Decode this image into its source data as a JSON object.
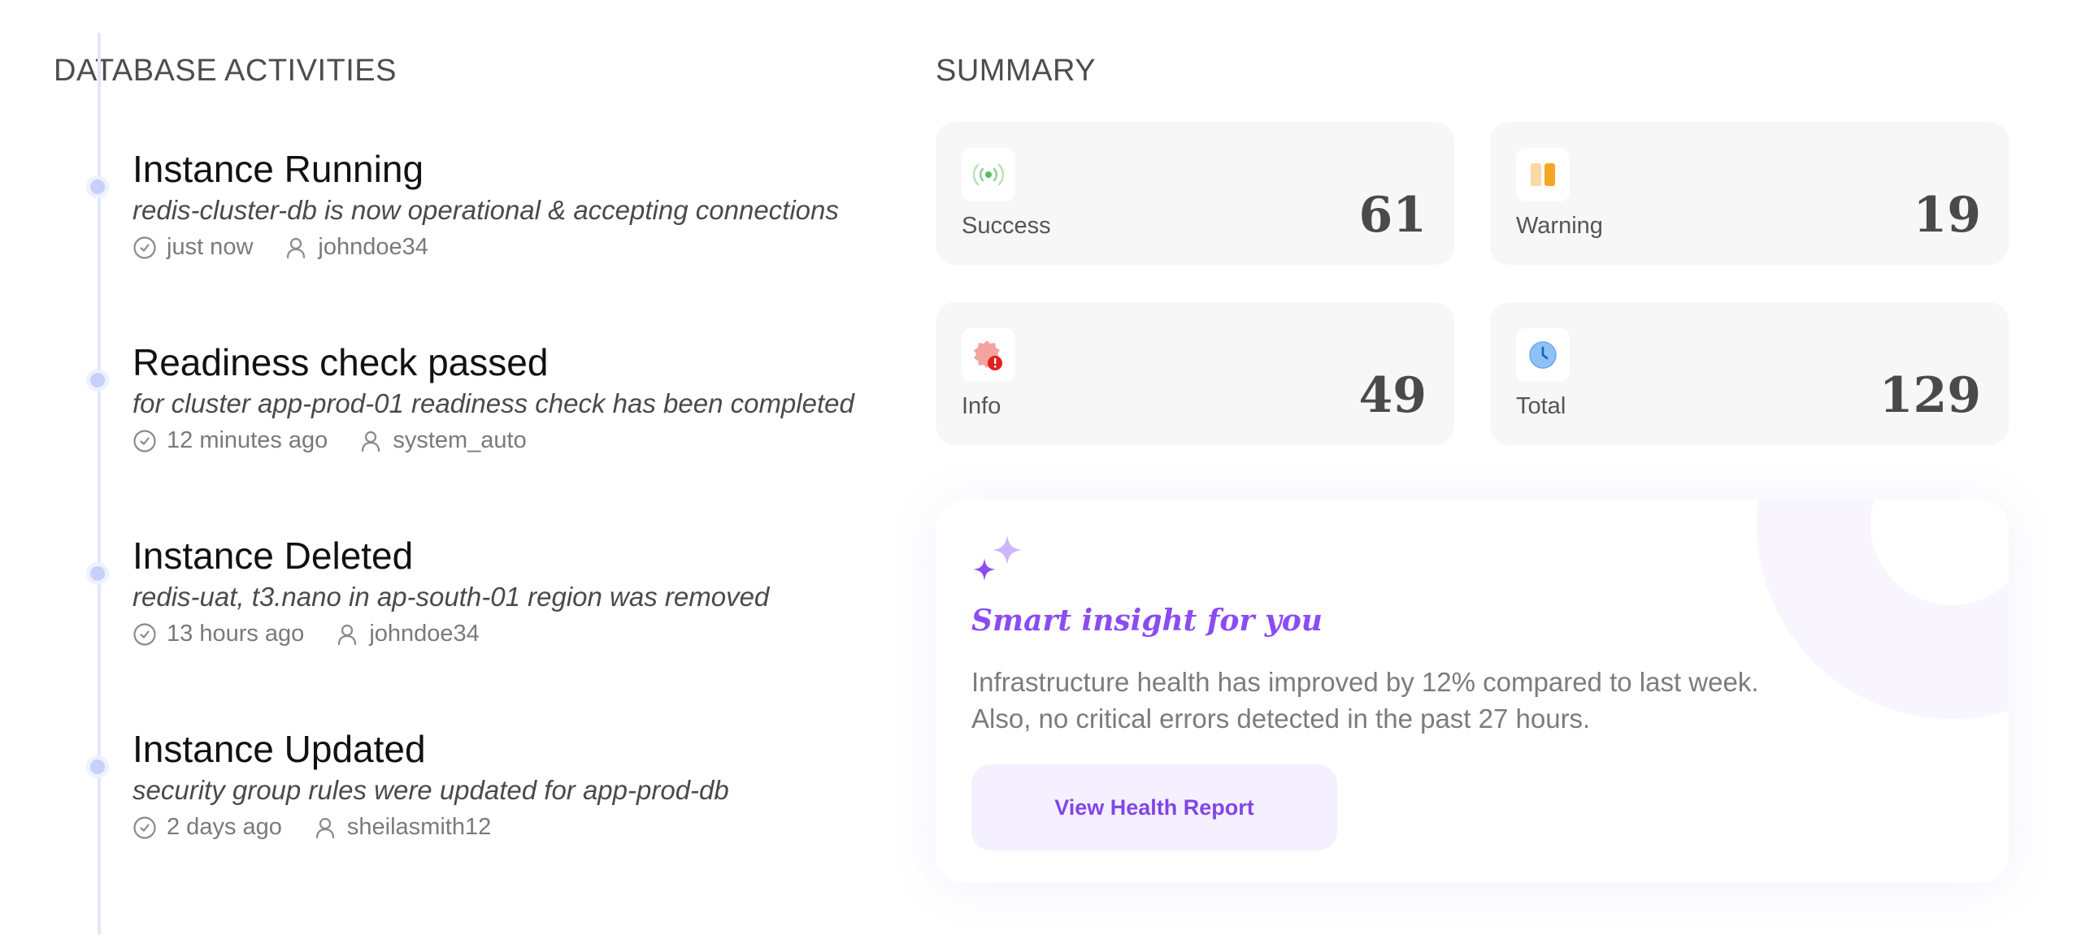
{
  "activities": {
    "title": "DATABASE ACTIVITIES",
    "items": [
      {
        "title": "Instance Running",
        "description": "redis-cluster-db is now operational & accepting connections",
        "time": "just now",
        "user": "johndoe34"
      },
      {
        "title": "Readiness check passed",
        "description": "for cluster app-prod-01 readiness check has been completed",
        "time": "12 minutes ago",
        "user": "system_auto"
      },
      {
        "title": "Instance Deleted",
        "description": "redis-uat, t3.nano in ap-south-01 region was removed",
        "time": "13 hours ago",
        "user": "johndoe34"
      },
      {
        "title": "Instance Updated",
        "description": "security group rules were updated for app-prod-db",
        "time": "2 days ago",
        "user": "sheilasmith12"
      }
    ]
  },
  "summary": {
    "title": "SUMMARY",
    "cards": [
      {
        "label": "Success",
        "count": "61",
        "icon": "signal-broadcast-icon",
        "color": "#5cb85c"
      },
      {
        "label": "Warning",
        "count": "19",
        "icon": "warning-bars-icon",
        "color": "#f5a623"
      },
      {
        "label": "Info",
        "count": "49",
        "icon": "alert-badge-icon",
        "color": "#e8453c"
      },
      {
        "label": "Total",
        "count": "129",
        "icon": "clock-icon",
        "color": "#4a90e2"
      }
    ]
  },
  "insight": {
    "headline": "Smart insight for you",
    "body_line1": "Infrastructure health has improved by 12% compared to last week.",
    "body_line2": "Also, no critical errors detected in the past 27 hours.",
    "button_label": "View Health Report",
    "accent": "#8b4cf2"
  }
}
